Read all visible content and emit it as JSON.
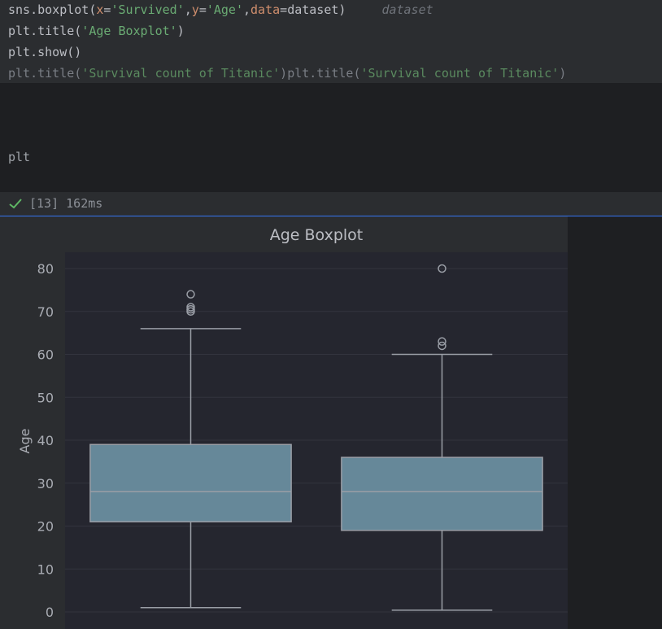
{
  "code": {
    "line1": {
      "fn": "sns.boxplot(",
      "p1": "x",
      "eq1": "=",
      "v1": "'Survived'",
      "c1": ",",
      "p2": "y",
      "eq2": "=",
      "v2": "'Age'",
      "c2": ",",
      "p3": "data",
      "eq3": "=",
      "v3": "dataset)",
      "hint": "dataset"
    },
    "line2": {
      "fn": "plt.title(",
      "str": "'Age Boxplot'",
      "end": ")"
    },
    "line3": "plt.show()",
    "line4": {
      "a_fn": "plt.title(",
      "a_str": "'Survival count of Titanic'",
      "a_end": ")",
      "b_fn": "plt.title(",
      "b_str": "'Survival count of Titanic'",
      "b_end": ")"
    }
  },
  "markdown": {
    "text": "plt"
  },
  "status": {
    "text": "[13] 162ms",
    "color": "#5fb865"
  },
  "chart_data": {
    "type": "box",
    "title": "Age Boxplot",
    "ylabel": "Age",
    "ylim": [
      0,
      82
    ],
    "yticks": [
      0,
      10,
      20,
      30,
      40,
      50,
      60,
      70,
      80
    ],
    "grid": true,
    "box_color": "#668899",
    "boxes": [
      {
        "whisker_low": 1,
        "q1": 21,
        "median": 28,
        "q3": 39,
        "whisker_high": 66,
        "outliers": [
          70,
          70.5,
          71,
          74
        ]
      },
      {
        "whisker_low": 0.4,
        "q1": 19,
        "median": 28,
        "q3": 36,
        "whisker_high": 60,
        "outliers": [
          62,
          63,
          80
        ]
      }
    ]
  }
}
